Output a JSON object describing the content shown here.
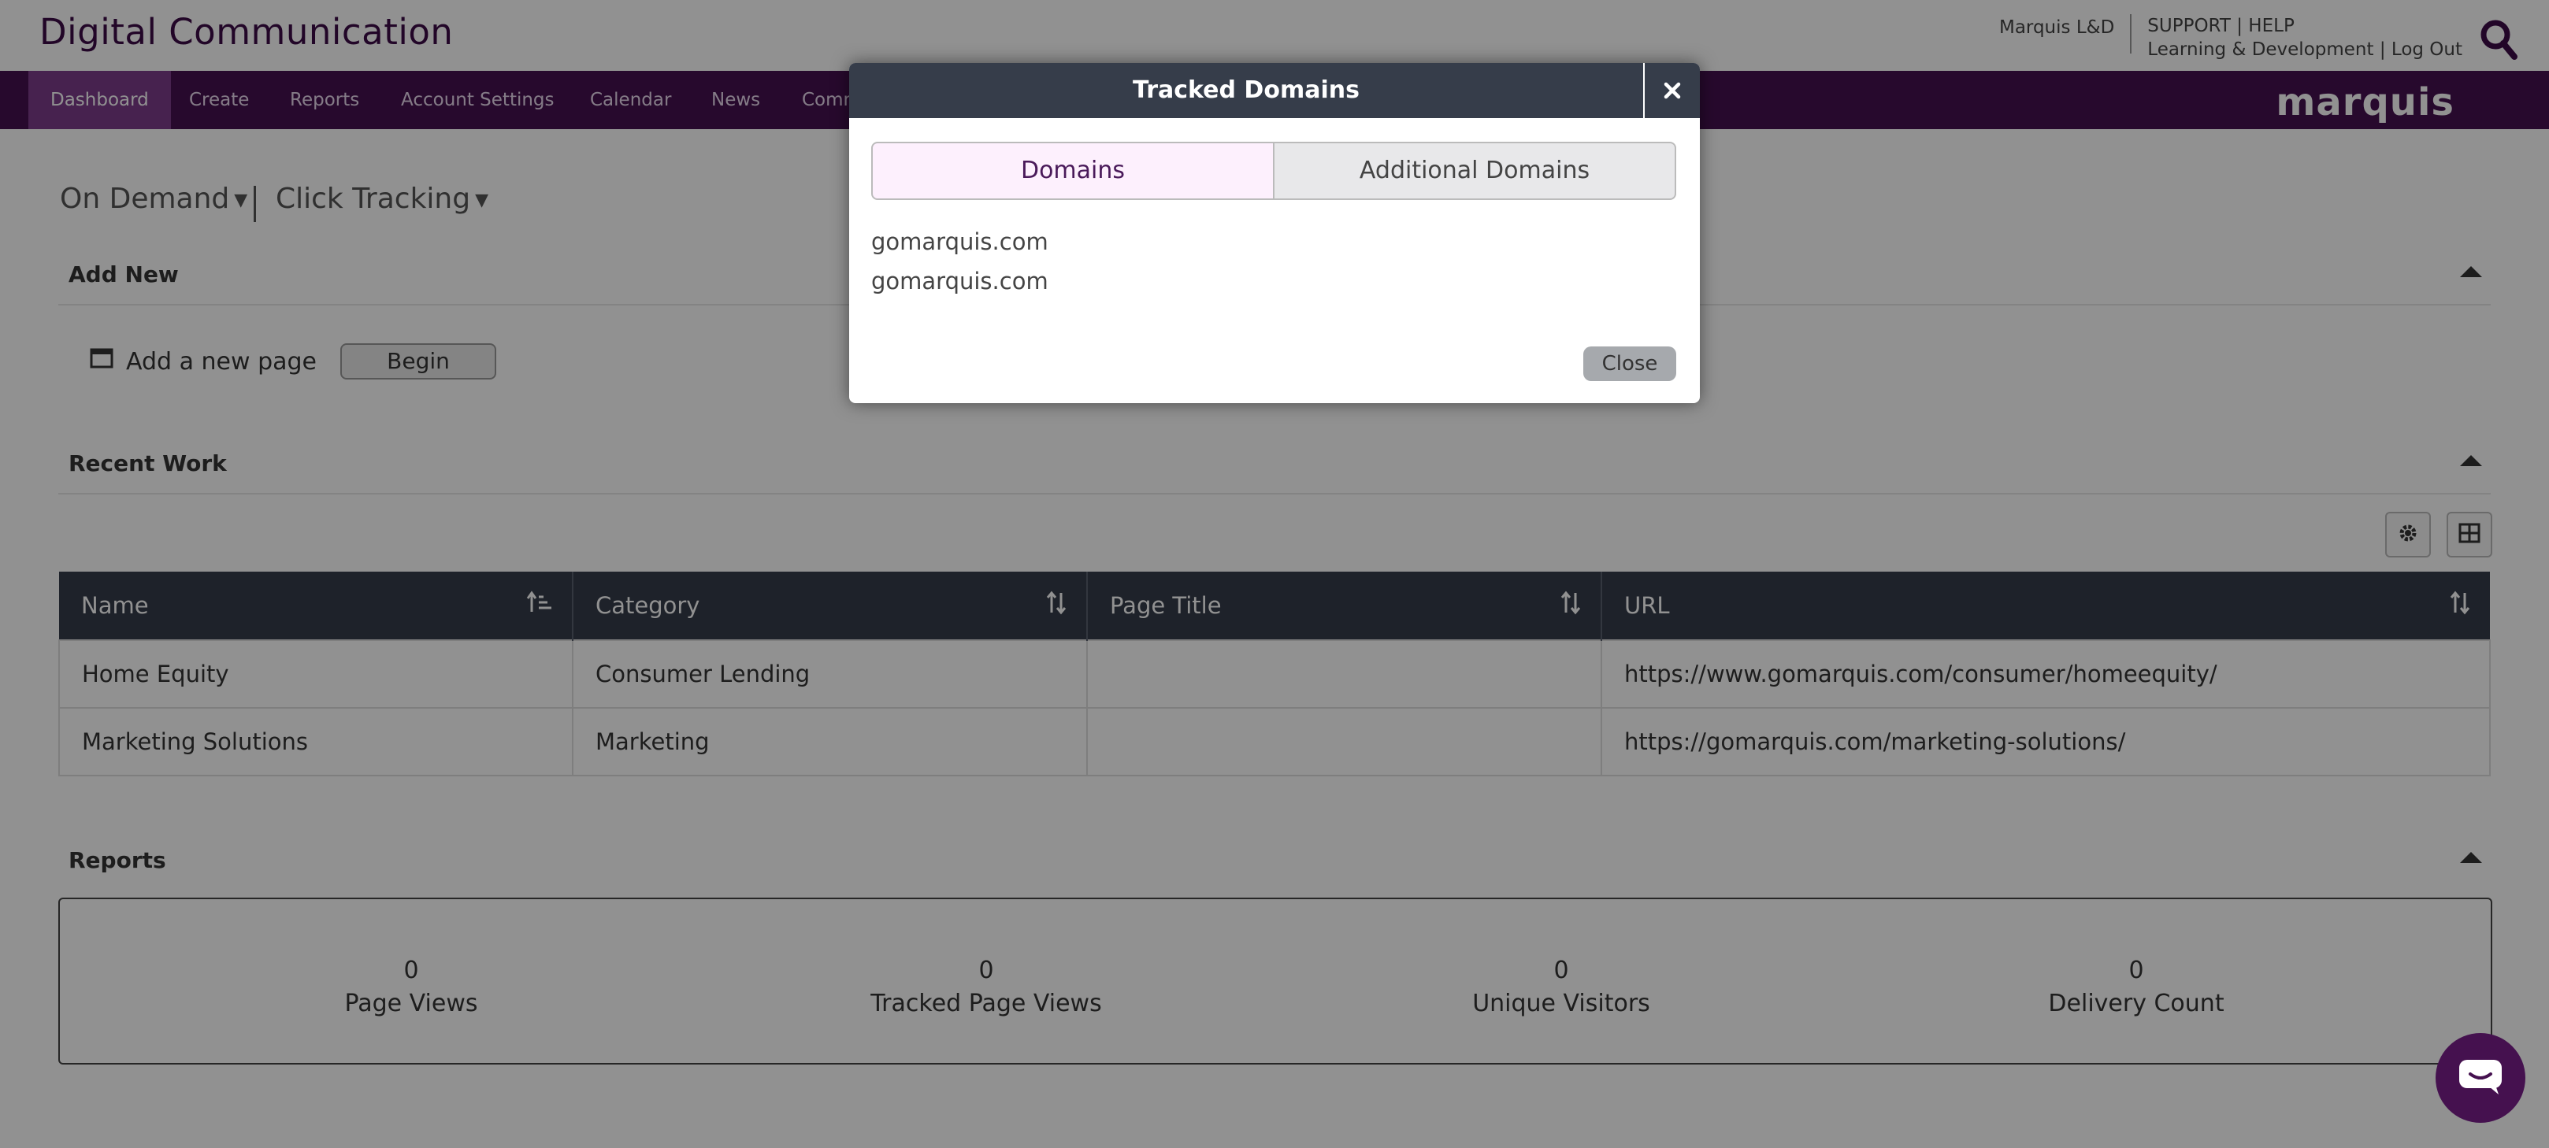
{
  "header": {
    "app_title": "Digital Communication",
    "user_name": "Marquis L&D",
    "support_label": "SUPPORT",
    "help_label": "HELP",
    "learning_label": "Learning & Development",
    "logout_label": "Log Out",
    "logo_text": "marquis"
  },
  "nav": {
    "items": [
      {
        "label": "Dashboard",
        "active": true
      },
      {
        "label": "Create"
      },
      {
        "label": "Reports"
      },
      {
        "label": "Account Settings"
      },
      {
        "label": "Calendar"
      },
      {
        "label": "News"
      },
      {
        "label": "Comm"
      }
    ]
  },
  "filters": {
    "mode_label": "On Demand",
    "view_label": "Click Tracking"
  },
  "add_new": {
    "title": "Add New",
    "new_page_label": "Add a new page",
    "begin_label": "Begin"
  },
  "recent_work": {
    "title": "Recent Work",
    "columns": [
      "Name",
      "Category",
      "Page Title",
      "URL"
    ],
    "rows": [
      {
        "name": "Home Equity",
        "category": "Consumer Lending",
        "page_title": "",
        "url": "https://www.gomarquis.com/consumer/homeequity/"
      },
      {
        "name": "Marketing Solutions",
        "category": "Marketing",
        "page_title": "",
        "url": "https://gomarquis.com/marketing-solutions/"
      }
    ]
  },
  "reports": {
    "title": "Reports",
    "stats": [
      {
        "value": "0",
        "label": "Page Views"
      },
      {
        "value": "0",
        "label": "Tracked Page Views"
      },
      {
        "value": "0",
        "label": "Unique Visitors"
      },
      {
        "value": "0",
        "label": "Delivery Count"
      }
    ]
  },
  "modal": {
    "title": "Tracked Domains",
    "tabs": [
      {
        "label": "Domains",
        "active": true
      },
      {
        "label": "Additional Domains",
        "active": false
      }
    ],
    "domains": [
      "gomarquis.com",
      "gomarquis.com"
    ],
    "close_label": "Close"
  },
  "colors": {
    "brand_purple": "#45114f",
    "nav_active": "#7d3c8c",
    "table_header": "#363d4a",
    "tab_active_bg": "#fdf0fd"
  }
}
